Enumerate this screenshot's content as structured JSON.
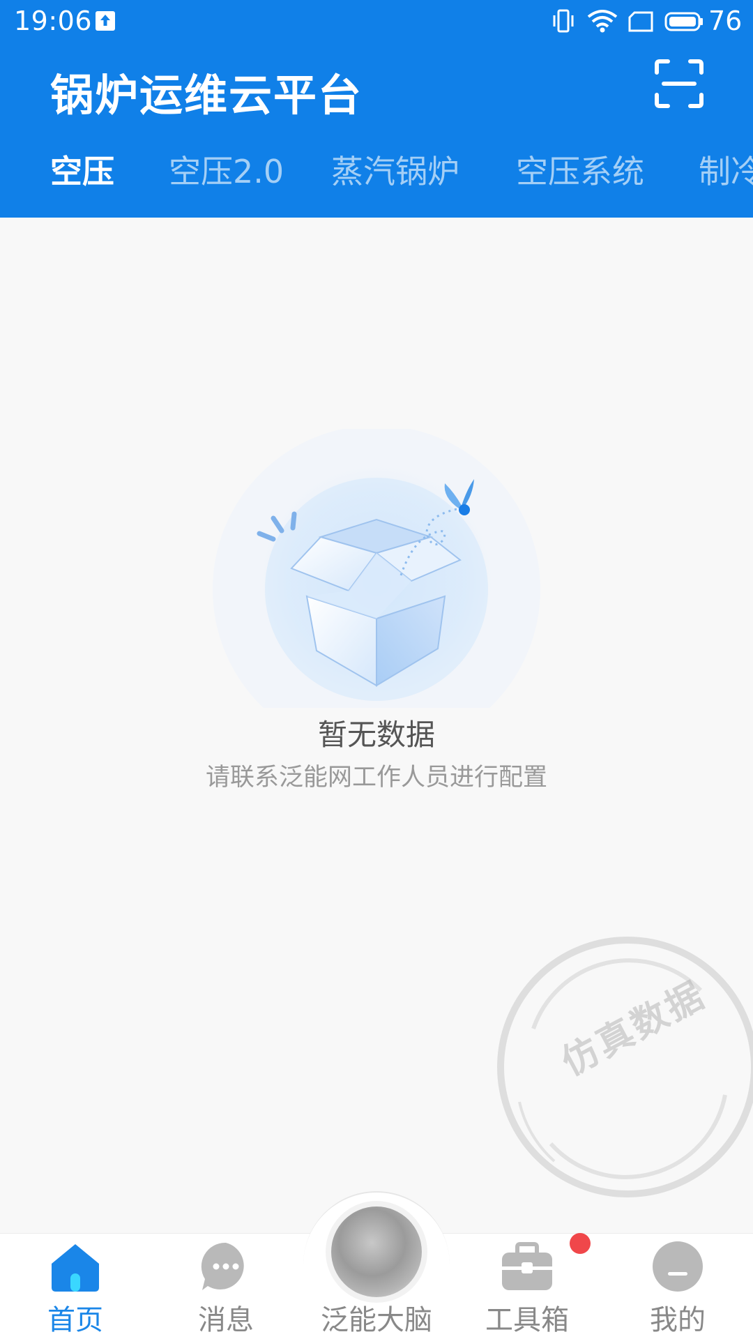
{
  "status_bar": {
    "time": "19:06",
    "battery_level": "76"
  },
  "header": {
    "title": "锅炉运维云平台"
  },
  "tabs": [
    {
      "label": "空压",
      "active": true
    },
    {
      "label": "空压2.0",
      "active": false
    },
    {
      "label": "蒸汽锅炉",
      "active": false
    },
    {
      "label": "空压系统",
      "active": false
    },
    {
      "label": "制冷",
      "active": false
    }
  ],
  "empty_state": {
    "title": "暂无数据",
    "subtitle": "请联系泛能网工作人员进行配置"
  },
  "watermark": {
    "text": "仿真数据"
  },
  "bottom_nav": [
    {
      "label": "首页",
      "icon": "home-icon",
      "active": true
    },
    {
      "label": "消息",
      "icon": "message-icon",
      "active": false
    },
    {
      "label": "泛能大脑",
      "icon": "brain-icon",
      "active": false
    },
    {
      "label": "工具箱",
      "icon": "toolbox-icon",
      "active": false,
      "badge": true
    },
    {
      "label": "我的",
      "icon": "profile-icon",
      "active": false
    }
  ],
  "colors": {
    "primary": "#1080e8",
    "active_nav": "#1a86e8",
    "inactive_nav": "#888888",
    "badge": "#f0474a",
    "background": "#f8f8f8"
  }
}
